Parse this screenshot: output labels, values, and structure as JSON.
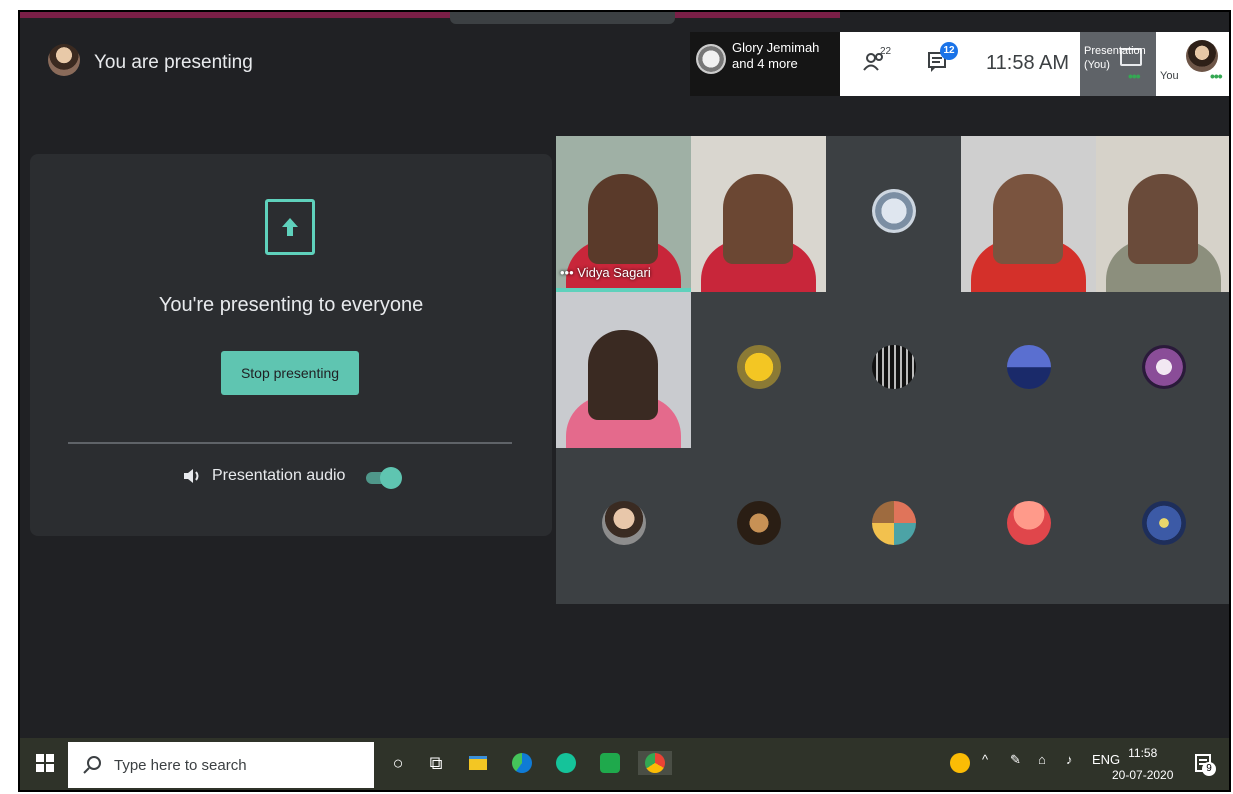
{
  "header": {
    "presenting_text": "You are presenting",
    "participants_label_line1": "Glory Jemimah",
    "participants_label_line2": "and 4 more",
    "people_count": "22",
    "chat_badge": "12",
    "time": "11:58 AM",
    "presentation_label_line1": "Presentation",
    "presentation_label_line2": "(You)",
    "self_label": "You",
    "more_dots": "•••"
  },
  "present_card": {
    "title": "You're presenting to everyone",
    "stop_button": "Stop presenting",
    "audio_label": "Presentation audio",
    "audio_on": true
  },
  "grid": {
    "active_speaker_name": "Vidya Sagari",
    "tile_more_dots": "•••"
  },
  "taskbar": {
    "search_placeholder": "Type here to search",
    "language": "ENG",
    "time": "11:58",
    "date": "20-07-2020",
    "notification_count": "9"
  },
  "colors": {
    "accent": "#5fc5b1",
    "meet_dark": "#202124",
    "tile_bg": "#3c4043",
    "header_accent": "#7b1f47"
  }
}
